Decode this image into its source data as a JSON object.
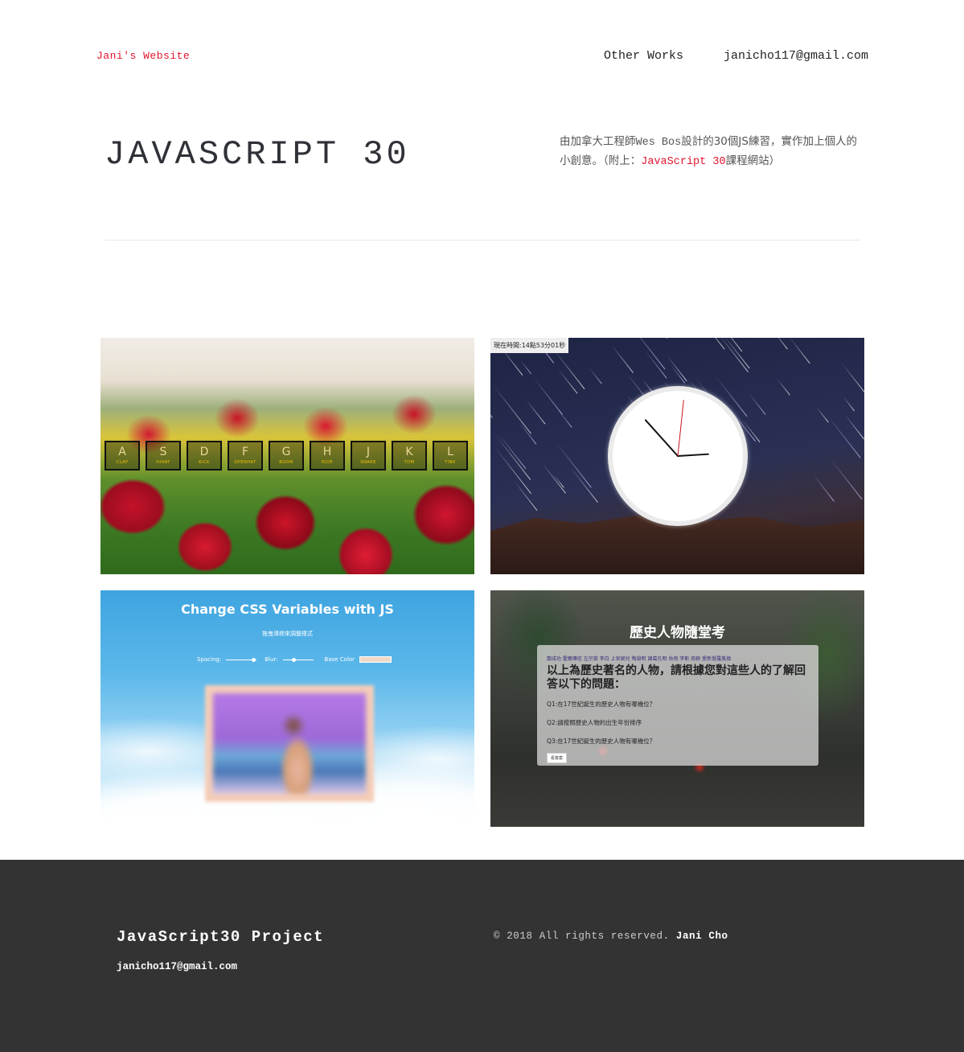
{
  "header": {
    "brand": "Jani's Website",
    "nav": [
      "Other Works",
      "janicho117@gmail.com"
    ]
  },
  "hero": {
    "title": "JAVASCRIPT 30",
    "desc_1": "由加拿大工程師",
    "desc_code": "Wes Bos",
    "desc_2": "設計的30個JS練習，實作加上個人的小創意。（附上：",
    "desc_link": "JavaScript 30",
    "desc_3": "課程網站）"
  },
  "projects": {
    "drum": {
      "keys": [
        {
          "key": "A",
          "sound": "CLAP"
        },
        {
          "key": "S",
          "sound": "HIHAT"
        },
        {
          "key": "D",
          "sound": "KICK"
        },
        {
          "key": "F",
          "sound": "OPENHAT"
        },
        {
          "key": "G",
          "sound": "BOOM"
        },
        {
          "key": "H",
          "sound": "RIDE"
        },
        {
          "key": "J",
          "sound": "SNARE"
        },
        {
          "key": "K",
          "sound": "TOM"
        },
        {
          "key": "L",
          "sound": "TINK"
        }
      ]
    },
    "clock": {
      "time_label": "現在時間:14點53分01秒",
      "time": {
        "hour": 14,
        "minute": 53,
        "second": 1
      }
    },
    "css_vars": {
      "title": "Change CSS Variables with JS",
      "subtitle": "拖曳滑桿來調整樣式",
      "spacing_label": "Spacing:",
      "blur_label": "Blur:",
      "base_color_label": "Base Color",
      "spacing_value": 0.95,
      "blur_value": 0.35,
      "base_color": "#f0d8c8"
    },
    "quiz": {
      "title": "歷史人物隨堂考",
      "names": "鄭成功 霍爾傳信 左宗棠 李白 上官婉兒 陶淵明 諸葛孔明 岳飛 李斯 商鞅 愛新覺羅胤禛",
      "prompt": "以上為歷史著名的人物，請根據您對這些人的了解回答以下的問題：",
      "questions": [
        "Q1:在17世紀誕生的歷史人物有哪幾位？",
        "Q2:請按照歷史人物的出生年份排序",
        "Q3:在17世紀誕生的歷史人物有哪幾位？"
      ],
      "button": "看答案"
    }
  },
  "footer": {
    "title": "JavaScript30 Project",
    "email": "janicho117@gmail.com",
    "copyright": "© 2018 All rights reserved.",
    "author": "Jani Cho"
  },
  "colors": {
    "accent": "#e0152d",
    "footer_bg": "#333333"
  }
}
